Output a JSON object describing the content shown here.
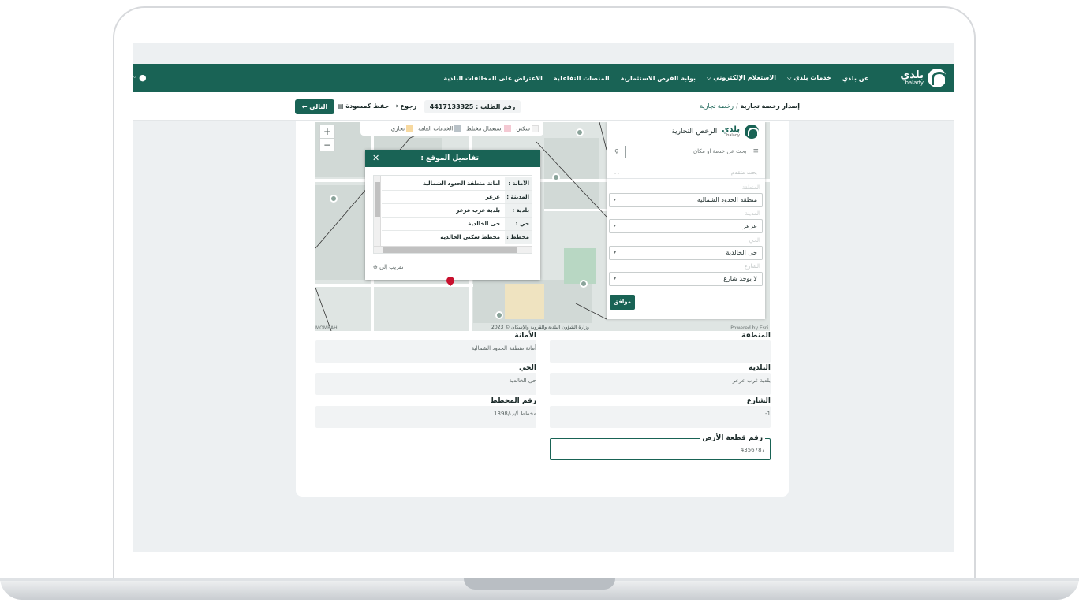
{
  "nav": {
    "logo_ar": "بلدي",
    "logo_en": "balady",
    "items": [
      {
        "label": "عن بلدي",
        "dropdown": false
      },
      {
        "label": "خدمات بلدي",
        "dropdown": true
      },
      {
        "label": "الاستعلام الإلكتروني",
        "dropdown": true
      },
      {
        "label": "بوابة الفرص الاستثمارية",
        "dropdown": false
      },
      {
        "label": "المنصات التفاعلية",
        "dropdown": false
      },
      {
        "label": "الاعتراض على المخالفات البلدية",
        "dropdown": false
      }
    ]
  },
  "subbar": {
    "breadcrumb_current": "إصدار رخصة تجارية",
    "breadcrumb_separator": "/",
    "breadcrumb_link": "رخصة تجارية",
    "request_number": "رقم الطلب : 4417133325",
    "back_label": "رجوع",
    "draft_label": "حفظ كمسودة",
    "next_label": "التالي"
  },
  "map": {
    "legend": [
      "سكني",
      "إستعمال مختلط",
      "الخدمات العامة",
      "تجاري"
    ],
    "legend_colors": [
      "#f2f2f2",
      "#f4c9d3",
      "#b9c2c8",
      "#f7d9a0"
    ],
    "credit": "وزارة الشؤون البلدية والقروية والإسكان © 2023",
    "left_attribution": "MOMRAH",
    "right_attribution": "Powered by Esri",
    "popup": {
      "title": "تفاصيل الموقع :",
      "rows": [
        {
          "key": "الأمانة :",
          "value": "أمانة منطقة الحدود الشمالية"
        },
        {
          "key": "المدينة :",
          "value": "عرعر"
        },
        {
          "key": "بلدية :",
          "value": "بلدية غرب عرعر"
        },
        {
          "key": "حي :",
          "value": "حى الخالدية"
        },
        {
          "key": "مخطط :",
          "value": "مخطط سكني الخالدية"
        }
      ],
      "zoom_to": "تقريب إلى"
    },
    "panel": {
      "brand": "بلدي",
      "brand_en": "balady",
      "title": "الرخص التجارية",
      "search_placeholder": "بحث عن خدمة او مكان",
      "advanced": "بحث متقدم",
      "fields": [
        {
          "label": "المنطقة",
          "value": "منطقة الحدود الشمالية"
        },
        {
          "label": "المدينة",
          "value": "عرعر"
        },
        {
          "label": "الحي",
          "value": "حى الخالدية"
        },
        {
          "label": "الشارع",
          "value": "لا يوجد شارع"
        }
      ],
      "ok_label": "موافق"
    }
  },
  "form": {
    "region": {
      "label": "المنطقة",
      "value": ""
    },
    "amanah": {
      "label": "الأمانة",
      "value": "أمانة منطقة الحدود الشمالية"
    },
    "municipality": {
      "label": "البلدية",
      "value": "بلدية غرب عرعر"
    },
    "district": {
      "label": "الحي",
      "value": "حى الخالدية"
    },
    "street": {
      "label": "الشارع",
      "value": "1-"
    },
    "plan_number": {
      "label": "رقم المخطط",
      "value": "مخطط أ/ب/1398"
    },
    "plot_number": {
      "label": "رقم قطعة الأرض",
      "value": "4356787"
    }
  },
  "colors": {
    "primary": "#196355",
    "background": "#edf0f2"
  }
}
